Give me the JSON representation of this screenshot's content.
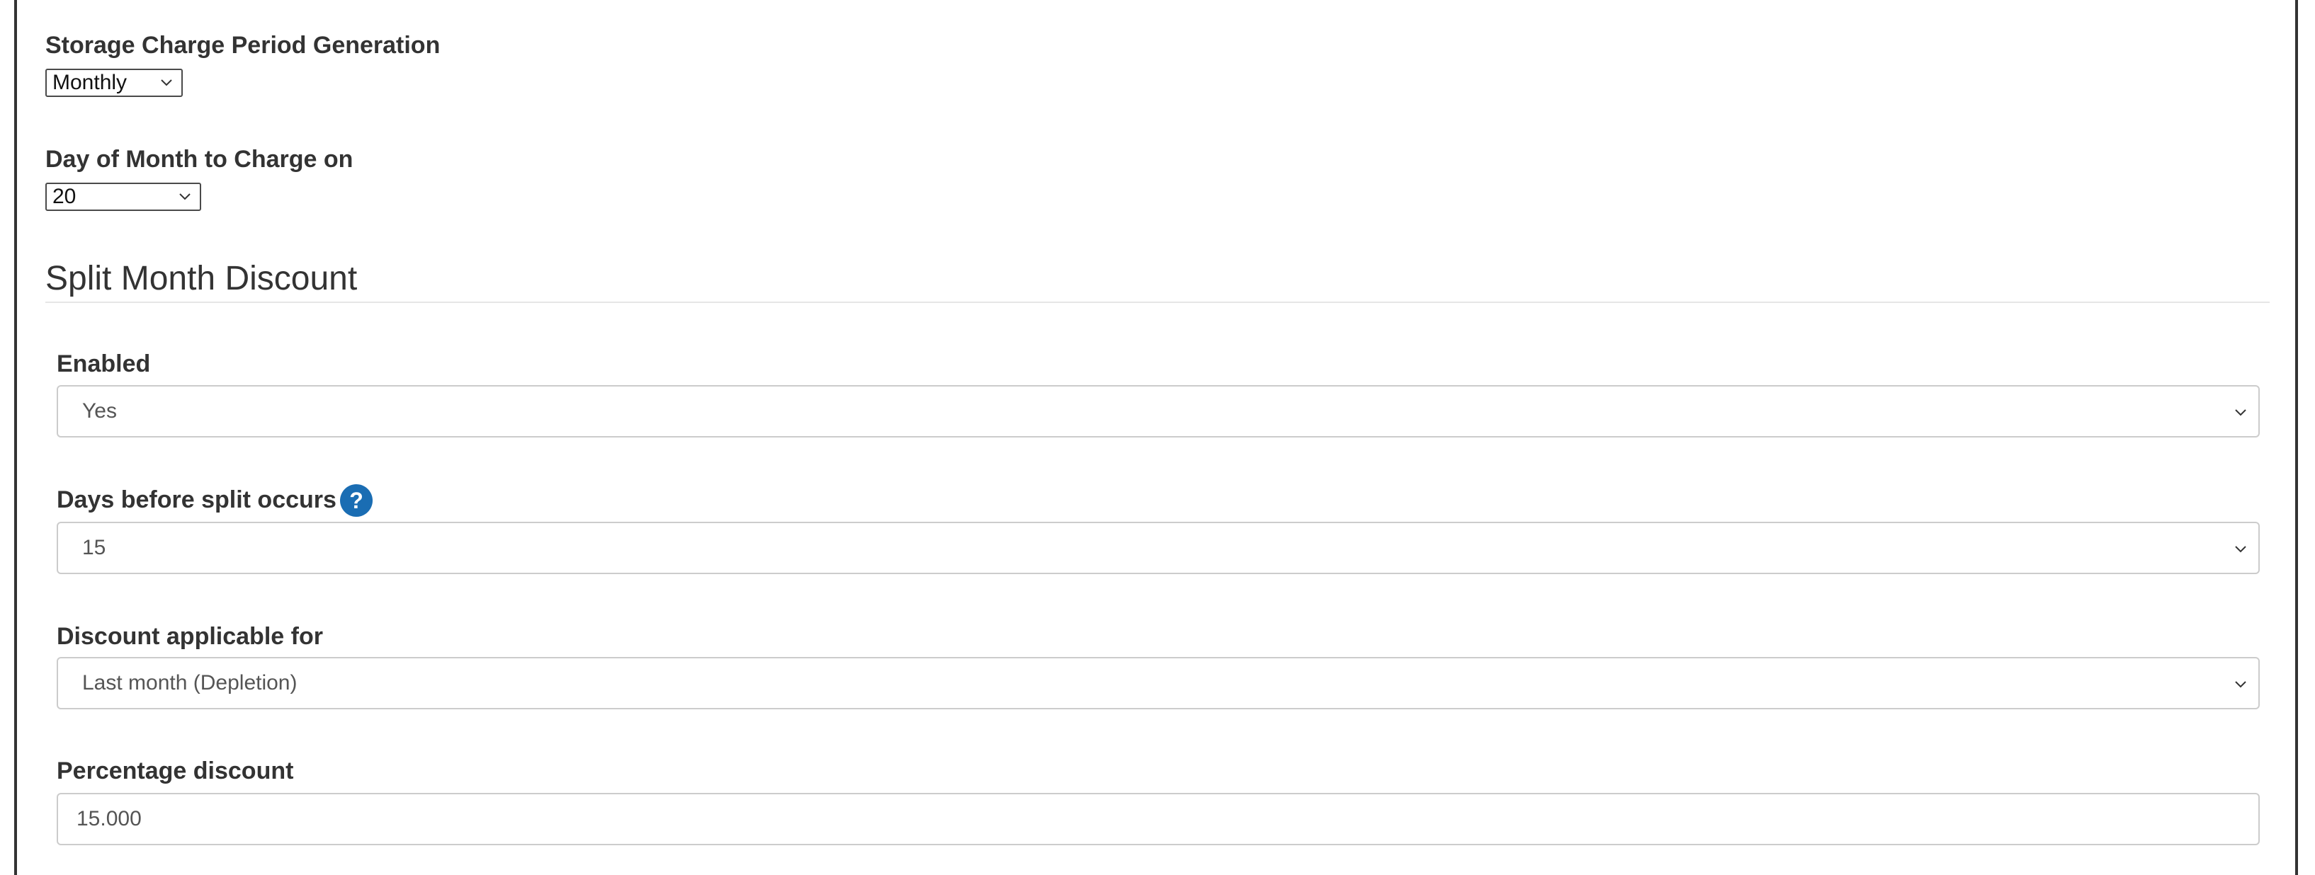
{
  "storage_charge": {
    "label": "Storage Charge Period Generation",
    "selected": "Monthly"
  },
  "day_of_month": {
    "label": "Day of Month to Charge on",
    "selected": "20"
  },
  "split_month": {
    "heading": "Split Month Discount",
    "enabled": {
      "label": "Enabled",
      "selected": "Yes"
    },
    "days_before_split": {
      "label": "Days before split occurs",
      "help_icon": "question-circle-icon",
      "help_glyph": "?",
      "selected": "15"
    },
    "discount_applicable": {
      "label": "Discount applicable for",
      "selected": "Last month (Depletion)"
    },
    "percentage_discount": {
      "label": "Percentage discount",
      "value": "15.000"
    }
  },
  "colors": {
    "text": "#333333",
    "help_icon_bg": "#1a6db3",
    "input_border": "#cccccc"
  }
}
